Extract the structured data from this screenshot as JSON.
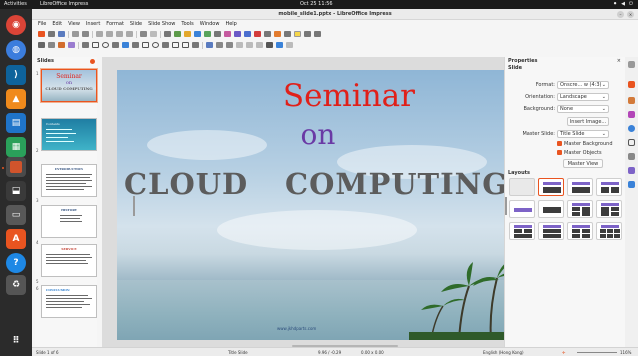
{
  "topbar": {
    "activities": "Activities",
    "app_name": "LibreOffice Impress",
    "clock": "Oct 25  11:56"
  },
  "window": {
    "title": "mobile_slide1.pptx - LibreOffice Impress"
  },
  "menu": [
    "File",
    "Edit",
    "View",
    "Insert",
    "Format",
    "Slide",
    "Slide Show",
    "Tools",
    "Window",
    "Help"
  ],
  "slide_pane": {
    "header": "Slides",
    "thumbs": [
      {
        "num": "1",
        "title": "Seminar",
        "sub": "on",
        "sub2": "CLOUD COMPUTING"
      },
      {
        "num": "2",
        "title": "Contents"
      },
      {
        "num": "3",
        "title": "INTRODUCTION"
      },
      {
        "num": "4",
        "title": "HISTORY"
      },
      {
        "num": "5",
        "title": "SERVICE"
      },
      {
        "num": "6",
        "title": "CONCLUSION"
      }
    ]
  },
  "slide": {
    "title": "Seminar",
    "on": "on",
    "word1": "CLOUD",
    "word2": "COMPUTING",
    "site": "www.jkhdparts.com"
  },
  "properties": {
    "title": "Properties",
    "section_slide": "Slide",
    "format_label": "Format:",
    "format_value": "Onscre... w (4:3)",
    "orientation_label": "Orientation:",
    "orientation_value": "Landscape",
    "background_label": "Background:",
    "background_value": "None",
    "insert_image": "Insert Image...",
    "master_slide_label": "Master Slide:",
    "master_slide_value": "Title Slide",
    "master_background": "Master Background",
    "master_objects": "Master Objects",
    "master_view": "Master View",
    "section_layouts": "Layouts"
  },
  "status": {
    "slide_of": "Slide 1 of 6",
    "layout": "Title Slide",
    "position": "9.96 / -0.29",
    "size": "0.00 x 0.00",
    "language": "English (Hong Kong)",
    "zoom": "116%"
  },
  "colors": {
    "accent": "#e95420",
    "title_red": "#e0201a",
    "on_purple": "#6a3aa5",
    "body_gray": "#5c5c5c"
  }
}
